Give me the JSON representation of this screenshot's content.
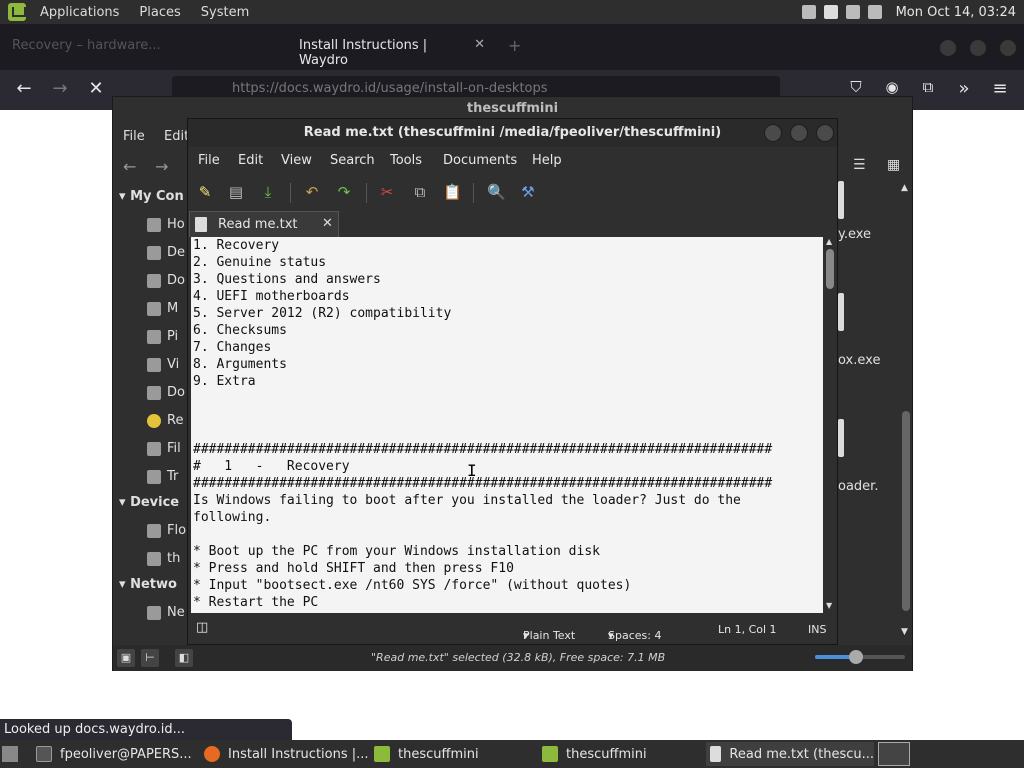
{
  "top_panel": {
    "menus": [
      "Applications",
      "Places",
      "System"
    ],
    "clock": "Mon Oct 14, 03:24"
  },
  "firefox": {
    "tab_inactive": "Recovery – hardware...",
    "tab_active": "Install Instructions | Waydro",
    "url": "https://docs.waydro.id/usage/install-on-desktops",
    "status_tip": "Looked up docs.waydro.id..."
  },
  "file_manager": {
    "title": "thescuffmini",
    "menu": [
      "File",
      "Edit"
    ],
    "sidebar": {
      "my_computer_head": "My Con",
      "places": [
        "Ho",
        "De",
        "Do",
        "M",
        "Pi",
        "Vi",
        "Do",
        "Re",
        "Fil",
        "Tr"
      ],
      "devices_head": "Device",
      "devices": [
        "Flo",
        "th"
      ],
      "network_head": "Netwo",
      "network": [
        "Ne"
      ]
    },
    "files": [
      "y.exe",
      "ox.exe",
      "oader."
    ],
    "status": "\"Read me.txt\" selected (32.8 kB), Free space: 7.1 MB",
    "zoom_level": 0.45
  },
  "editor": {
    "title": "Read me.txt (thescuffmini /media/fpeoliver/thescuffmini)",
    "menu": [
      "File",
      "Edit",
      "View",
      "Search",
      "Tools",
      "Documents",
      "Help"
    ],
    "tab_label": "Read me.txt",
    "text": "1. Recovery\n2. Genuine status\n3. Questions and answers\n4. UEFI motherboards\n5. Server 2012 (R2) compatibility\n6. Checksums\n7. Changes\n8. Arguments\n9. Extra\n\n\n\n##########################################################################\n#   1   -   Recovery\n##########################################################################\nIs Windows failing to boot after you installed the loader? Just do the\nfollowing.\n\n* Boot up the PC from your Windows installation disk\n* Press and hold SHIFT and then press F10\n* Input \"bootsect.exe /nt60 SYS /force\" (without quotes)\n* Restart the PC",
    "status": {
      "syntax": "Plain Text",
      "spaces": "Spaces: 4",
      "position": "Ln 1, Col 1",
      "mode": "INS"
    }
  },
  "taskbar": {
    "tasks": [
      "fpeoliver@PAPERS...",
      "Install Instructions |...",
      "thescuffmini",
      "thescuffmini",
      "Read me.txt (thescu..."
    ]
  }
}
